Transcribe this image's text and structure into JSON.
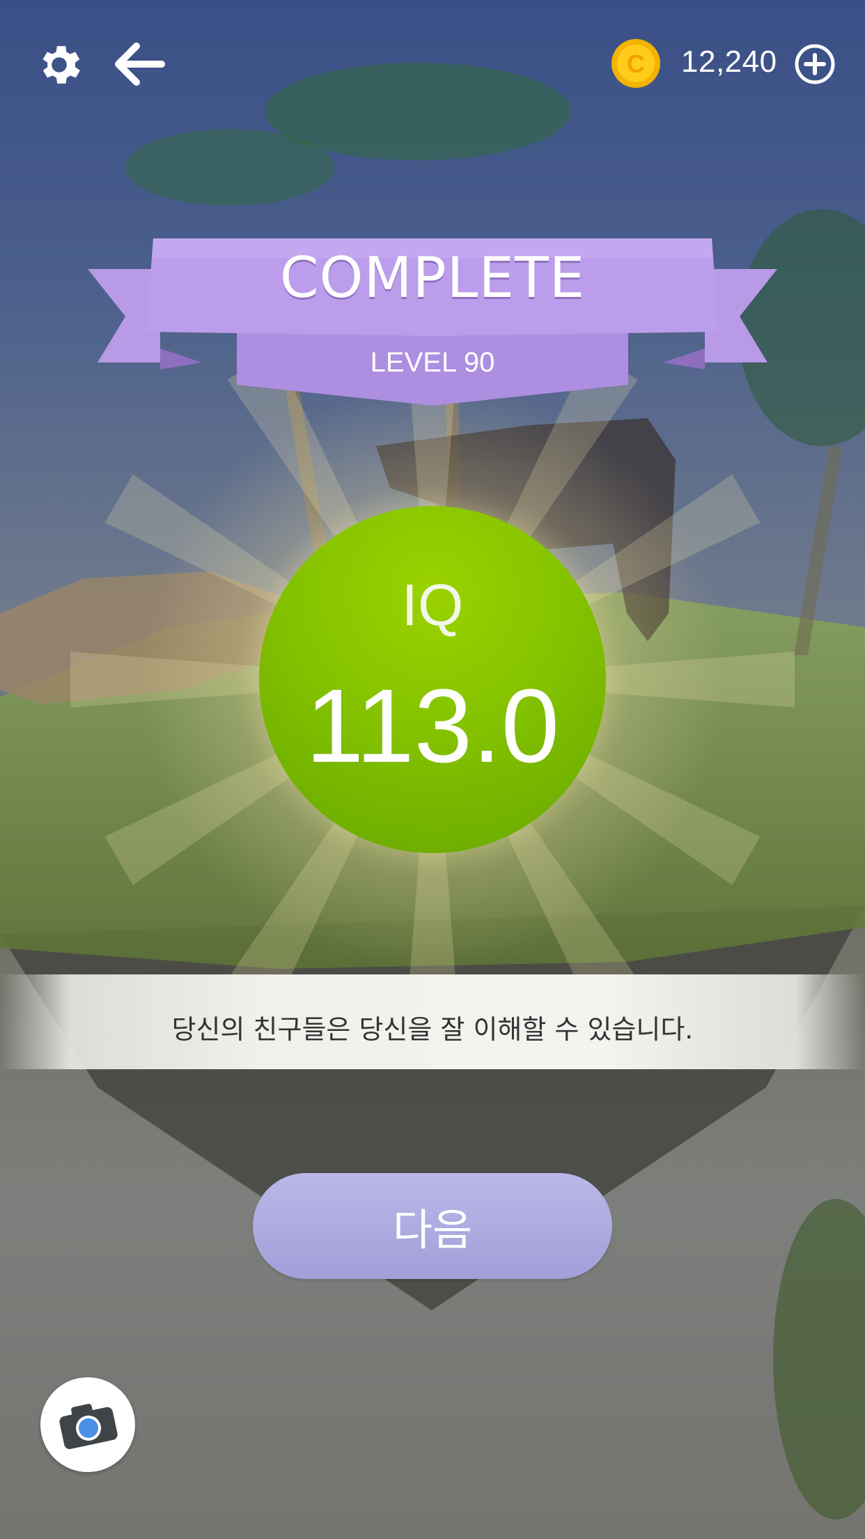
{
  "header": {
    "settings_icon": "gear-icon",
    "back_icon": "arrow-left-icon",
    "coin_icon": "coin-icon",
    "coin_letter": "C",
    "coins": "12,240",
    "add_icon": "plus-circle-icon"
  },
  "banner": {
    "title": "COMPLETE",
    "subtitle": "LEVEL 90"
  },
  "score": {
    "label": "IQ",
    "value": "113.0"
  },
  "message": "당신의 친구들은 당신을 잘 이해할 수 있습니다.",
  "next_button": "다음",
  "camera_icon": "camera-icon",
  "colors": {
    "banner": "#b99ce8",
    "circle": "#7ab800",
    "button": "#a9a6de",
    "coin": "#f5b800"
  }
}
